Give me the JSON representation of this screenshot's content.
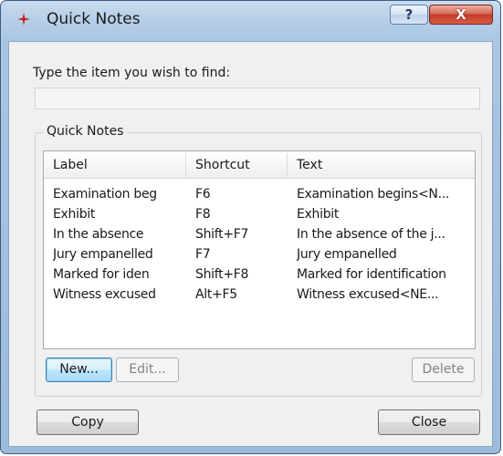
{
  "window": {
    "title": "Quick Notes",
    "help_label": "?",
    "close_label": "X"
  },
  "find": {
    "label": "Type the item you wish to find:",
    "value": "",
    "placeholder": ""
  },
  "group": {
    "title": "Quick Notes"
  },
  "table": {
    "columns": [
      "Label",
      "Shortcut",
      "Text"
    ],
    "rows": [
      [
        "Examination beg",
        "F6",
        "Examination begins<N..."
      ],
      [
        "Exhibit",
        "F8",
        "Exhibit"
      ],
      [
        "In the absence",
        "Shift+F7",
        "In the absence of the j..."
      ],
      [
        "Jury empanelled",
        "F7",
        "Jury empanelled"
      ],
      [
        "Marked for iden",
        "Shift+F8",
        "Marked for identification"
      ],
      [
        "Witness excused",
        "Alt+F5",
        "Witness excused<NE..."
      ]
    ]
  },
  "buttons": {
    "new": "New...",
    "edit": "Edit...",
    "delete": "Delete",
    "copy": "Copy",
    "close": "Close"
  },
  "colors": {
    "title_gradient_top": "#c8dcef",
    "close_button": "#c43e2a",
    "focus_border": "#3c7fb1"
  },
  "icons": {
    "app": "quick-notes-icon",
    "help": "help-icon",
    "close": "close-icon"
  }
}
